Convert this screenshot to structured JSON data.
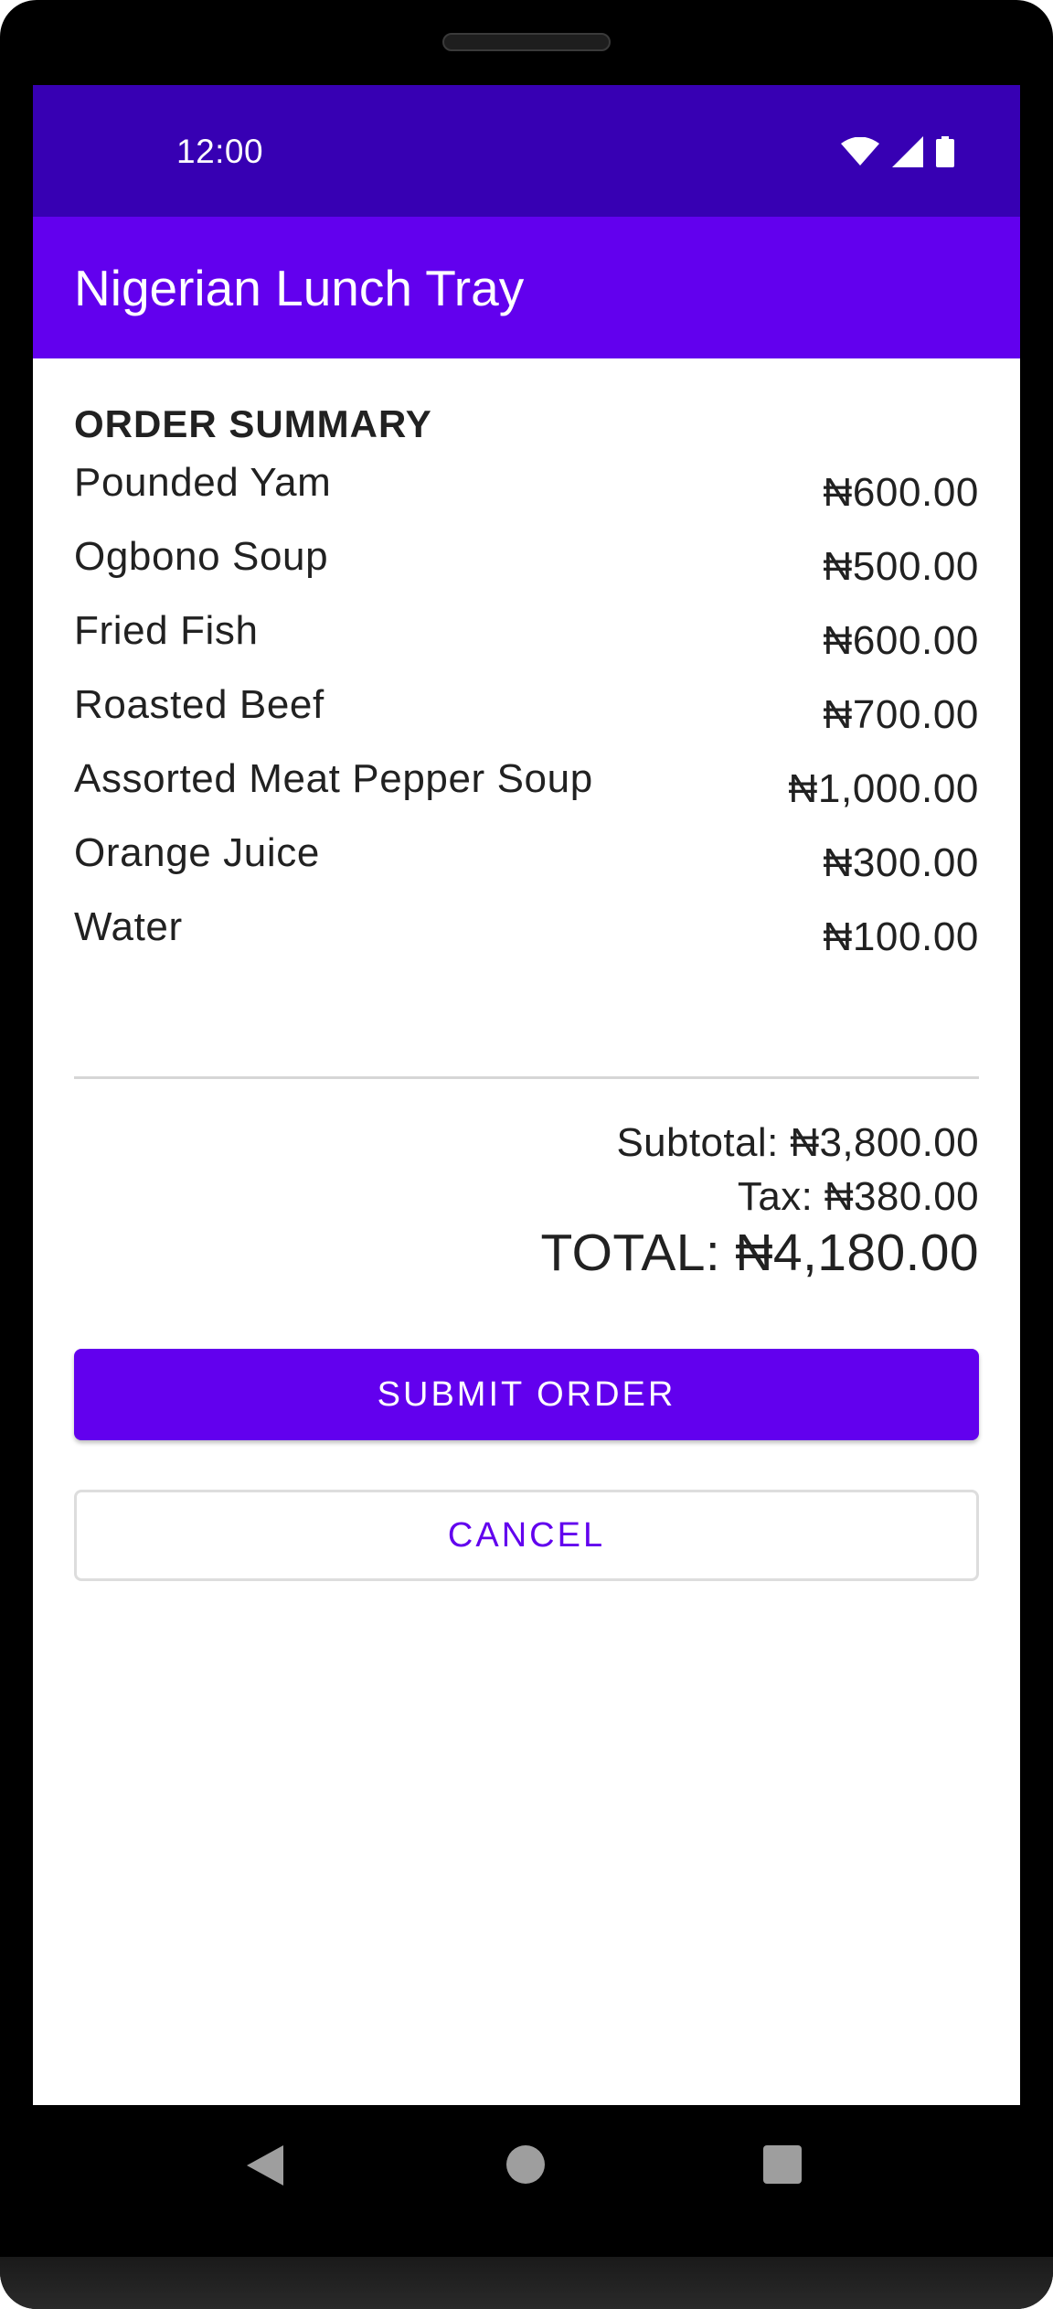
{
  "colors": {
    "status_bar": "#3700B3",
    "primary": "#6200EE",
    "text_primary": "#212121",
    "divider": "#D6D6D6"
  },
  "status_bar": {
    "time": "12:00",
    "icons": [
      "wifi-icon",
      "signal-icon",
      "battery-icon"
    ]
  },
  "app_bar": {
    "title": "Nigerian Lunch Tray"
  },
  "order_summary": {
    "heading": "ORDER SUMMARY",
    "items": [
      {
        "name": "Pounded Yam",
        "price": "₦600.00"
      },
      {
        "name": "Ogbono Soup",
        "price": "₦500.00"
      },
      {
        "name": "Fried Fish",
        "price": "₦600.00"
      },
      {
        "name": "Roasted Beef",
        "price": "₦700.00"
      },
      {
        "name": "Assorted Meat Pepper Soup",
        "price": "₦1,000.00"
      },
      {
        "name": "Orange Juice",
        "price": "₦300.00"
      },
      {
        "name": "Water",
        "price": "₦100.00"
      }
    ],
    "subtotal": "Subtotal: ₦3,800.00",
    "tax": "Tax: ₦380.00",
    "total": "TOTAL: ₦4,180.00"
  },
  "actions": {
    "submit_label": "SUBMIT ORDER",
    "cancel_label": "CANCEL"
  },
  "nav_bar": {
    "icons": [
      "back-icon",
      "home-icon",
      "recents-icon"
    ]
  }
}
